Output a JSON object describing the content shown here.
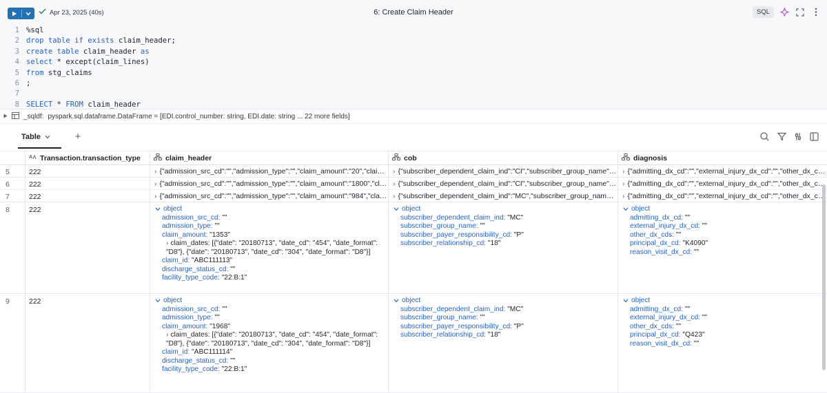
{
  "cell": {
    "status_date": "Apr 23, 2025 (40s)",
    "title": "6: Create Claim Header",
    "language": "SQL"
  },
  "code": [
    {
      "n": "1",
      "text": "%sql"
    },
    {
      "n": "2",
      "text": "drop table if exists claim_header;"
    },
    {
      "n": "3",
      "text": "create table claim_header as"
    },
    {
      "n": "4",
      "text": "select * except(claim_lines)"
    },
    {
      "n": "5",
      "text": "from stg_claims"
    },
    {
      "n": "6",
      "text": ";"
    },
    {
      "n": "7",
      "text": ""
    },
    {
      "n": "8",
      "text": "SELECT * FROM claim_header"
    }
  ],
  "df_summary": {
    "name": "_sqldf:",
    "type": "pyspark.sql.dataframe.DataFrame = [EDI.control_number: string, EDI.date: string ... 22 more fields]"
  },
  "results": {
    "tab_label": "Table",
    "add_label": "+"
  },
  "columns": {
    "c1": "Transaction.transaction_type",
    "c2": "claim_header",
    "c3": "cob",
    "c4": "diagnosis"
  },
  "rows_collapsed": [
    {
      "num": "5",
      "type": "222",
      "claim_header": "{\"admission_src_cd\":\"\",\"admission_type\":\"\",\"claim_amount\":\"20\",\"claim_d...",
      "cob": "{\"subscriber_dependent_claim_ind\":\"CI\",\"subscriber_group_name\":\"C...",
      "diagnosis": "{\"admitting_dx_cd\":\"\",\"external_injury_dx_cd\":\"\",\"other_dx_cds\":\""
    },
    {
      "num": "6",
      "type": "222",
      "claim_header": "{\"admission_src_cd\":\"\",\"admission_type\":\"\",\"claim_amount\":\"1800\",\"claim...",
      "cob": "{\"subscriber_dependent_claim_ind\":\"CI\",\"subscriber_group_name\":\"\",\"...",
      "diagnosis": "{\"admitting_dx_cd\":\"\",\"external_injury_dx_cd\":\"\",\"other_dx_cds\":\""
    },
    {
      "num": "7",
      "type": "222",
      "claim_header": "{\"admission_src_cd\":\"\",\"admission_type\":\"\",\"claim_amount\":\"984\",\"claim_...",
      "cob": "{\"subscriber_dependent_claim_ind\":\"MC\",\"subscriber_group_name\":\"\",...",
      "diagnosis": "{\"admitting_dx_cd\":\"\",\"external_injury_dx_cd\":\"\",\"other_dx_cds\":\""
    }
  ],
  "rows_expanded": [
    {
      "num": "8",
      "type": "222",
      "claim_header": {
        "label": "object",
        "admission_src_cd": "\"\"",
        "admission_type": "\"\"",
        "claim_amount": "\"1353\"",
        "claim_dates": "claim_dates: [{\"date\": \"20180713\", \"date_cd\": \"454\", \"date_format\": \"D8\"}, {\"date\": \"20180713\", \"date_cd\": \"304\", \"date_format\": \"D8\"}]",
        "claim_id": "\"ABC111113\"",
        "discharge_status_cd": "\"\"",
        "facility_type_code": "\"22:B:1\""
      },
      "cob": {
        "label": "object",
        "subscriber_dependent_claim_ind": "\"MC\"",
        "subscriber_group_name": "\"\"",
        "subscriber_payer_responsibility_cd": "\"P\"",
        "subscriber_relationship_cd": "\"18\""
      },
      "diagnosis": {
        "label": "object",
        "admitting_dx_cd": "\"\"",
        "external_injury_dx_cd": "\"\"",
        "other_dx_cds": "\"\"",
        "principal_dx_cd": "\"K4090\"",
        "reason_visit_dx_cd": "\"\""
      }
    },
    {
      "num": "9",
      "type": "222",
      "claim_header": {
        "label": "object",
        "admission_src_cd": "\"\"",
        "admission_type": "\"\"",
        "claim_amount": "\"1968\"",
        "claim_dates": "claim_dates: [{\"date\": \"20180713\", \"date_cd\": \"454\", \"date_format\": \"D8\"}, {\"date\": \"20180713\", \"date_cd\": \"304\", \"date_format\": \"D8\"}]",
        "claim_id": "\"ABC111114\"",
        "discharge_status_cd": "\"\"",
        "facility_type_code": "\"22:B:1\""
      },
      "cob": {
        "label": "object",
        "subscriber_dependent_claim_ind": "\"MC\"",
        "subscriber_group_name": "\"\"",
        "subscriber_payer_responsibility_cd": "\"P\"",
        "subscriber_relationship_cd": "\"18\""
      },
      "diagnosis": {
        "label": "object",
        "admitting_dx_cd": "\"\"",
        "external_injury_dx_cd": "\"\"",
        "other_dx_cds": "\"\"",
        "principal_dx_cd": "\"Q423\"",
        "reason_visit_dx_cd": "\"\""
      }
    }
  ],
  "colors": {
    "accent": "#2272b4",
    "key_blue": "#2563c9",
    "sparkle": "#c24fd8"
  }
}
